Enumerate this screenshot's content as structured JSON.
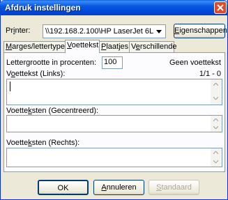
{
  "window": {
    "title": "Afdruk instellingen"
  },
  "printer": {
    "label_pre": "Pr",
    "label_u": "i",
    "label_post": "nter:",
    "selected": "\\\\192.168.2.100\\HP LaserJet 6L",
    "properties_pre": "",
    "properties_u": "E",
    "properties_post": "igenschappen"
  },
  "tabs": [
    {
      "pre": "",
      "u": "M",
      "post": "arges/lettertype"
    },
    {
      "pre": "",
      "u": "V",
      "post": "oettekst"
    },
    {
      "pre": "",
      "u": "P",
      "post": "laatjes"
    },
    {
      "pre": "V",
      "u": "e",
      "post": "rschillende"
    }
  ],
  "footer_tab": {
    "font_size_label": "Lettergrootte in procenten:",
    "font_size_value": "100",
    "no_footer": "Geen voettekst",
    "page_counter": "1/1 - 0",
    "left": {
      "pre": "V",
      "u": "o",
      "post": "ettekst (Links):",
      "value": ""
    },
    "center": {
      "pre": "Voette",
      "u": "k",
      "post": "sten (Gecentreerd):",
      "value": ""
    },
    "right": {
      "pre": "Voette",
      "u": "k",
      "post": "sten (Rechts):",
      "value": ""
    }
  },
  "buttons": {
    "ok": "OK",
    "cancel_pre": "",
    "cancel_u": "A",
    "cancel_post": "nnuleren",
    "default_pre": "",
    "default_u": "S",
    "default_post": "tandaard"
  }
}
